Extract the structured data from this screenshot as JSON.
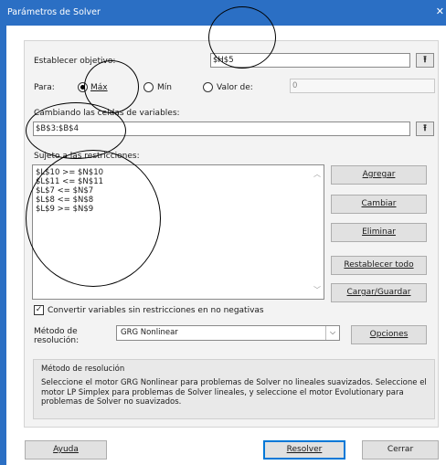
{
  "window": {
    "title": "Parámetros de Solver",
    "close_glyph": "✕"
  },
  "objective": {
    "label": "Establecer objetivo:",
    "value": "$H$5",
    "ref_icon": "arrow-up-icon"
  },
  "to": {
    "label": "Para:",
    "options": [
      {
        "label": "Máx",
        "selected": true
      },
      {
        "label": "Mín",
        "selected": false
      },
      {
        "label": "Valor de:",
        "selected": false
      }
    ],
    "value_of": "0"
  },
  "variables": {
    "label": "Cambiando las celdas de variables:",
    "value": "$B$3:$B$4"
  },
  "constraints": {
    "label": "Sujeto a las restricciones:",
    "items": [
      "$L$10 >= $N$10",
      "$L$11 <= $N$11",
      "$L$7 <= $N$7",
      "$L$8 <= $N$8",
      "$L$9 >= $N$9"
    ]
  },
  "buttons": {
    "add": "Agregar",
    "change": "Cambiar",
    "delete": "Eliminar",
    "reset": "Restablecer todo",
    "load_save": "Cargar/Guardar",
    "options": "Opciones",
    "help": "Ayuda",
    "solve": "Resolver",
    "close": "Cerrar"
  },
  "nonnegative": {
    "label": "Convertir variables sin restricciones en no negativas",
    "checked": true
  },
  "method": {
    "label_line1": "Método de",
    "label_line2": "resolución:",
    "selected": "GRG Nonlinear"
  },
  "description": {
    "title": "Método de resolución",
    "text": "Seleccione el motor GRG Nonlinear para problemas de Solver no lineales suavizados. Seleccione el motor LP Simplex para problemas de Solver lineales, y seleccione el motor Evolutionary para problemas de Solver no suavizados."
  },
  "colors": {
    "titlebar": "#2b6fc4",
    "panel": "#f3f3f3",
    "accent": "#0078d7"
  }
}
